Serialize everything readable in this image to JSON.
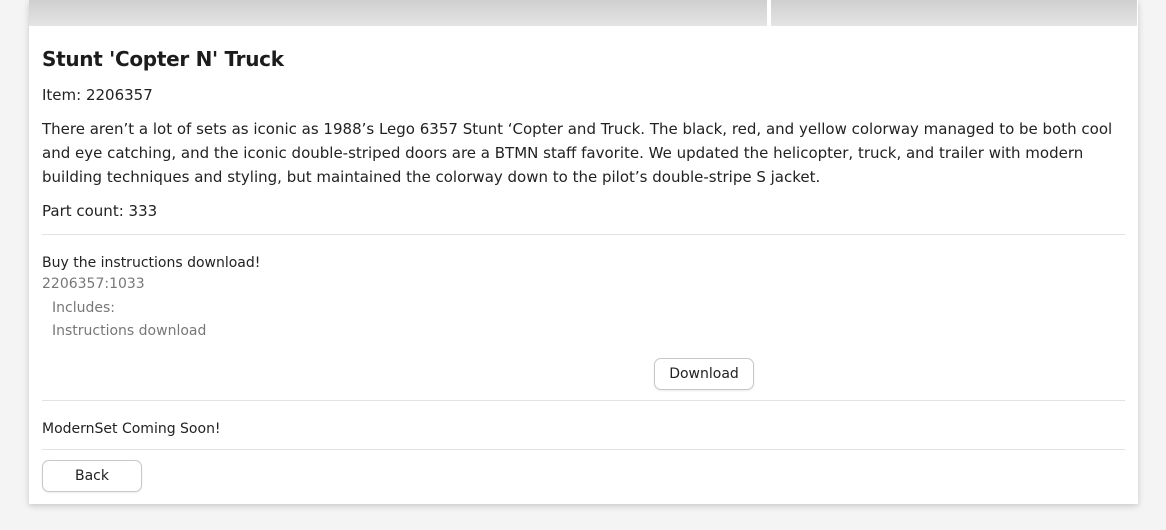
{
  "product": {
    "title": "Stunt 'Copter N' Truck",
    "item_line": "Item: 2206357",
    "description": "There aren’t a lot of sets as iconic as 1988’s Lego 6357 Stunt ‘Copter and Truck. The black, red, and yellow colorway managed to be both cool and eye catching, and the iconic double-striped doors are a BTMN staff favorite. We updated the helicopter, truck, and trailer with modern building techniques and styling, but maintained the colorway down to the pilot’s double-stripe S jacket.",
    "part_count_line": "Part count: 333"
  },
  "instructions": {
    "buy_label": "Buy the instructions download!",
    "sku": "2206357:1033",
    "includes_label": "Includes:",
    "includes_item": "Instructions download",
    "download_button": "Download"
  },
  "modernset": {
    "status": "ModernSet Coming Soon!"
  },
  "navigation": {
    "back_button": "Back"
  },
  "colors": {
    "page_background": "#f4f4f4",
    "card_background": "#ffffff",
    "muted_text": "#777777",
    "divider": "#e2e2e2"
  }
}
